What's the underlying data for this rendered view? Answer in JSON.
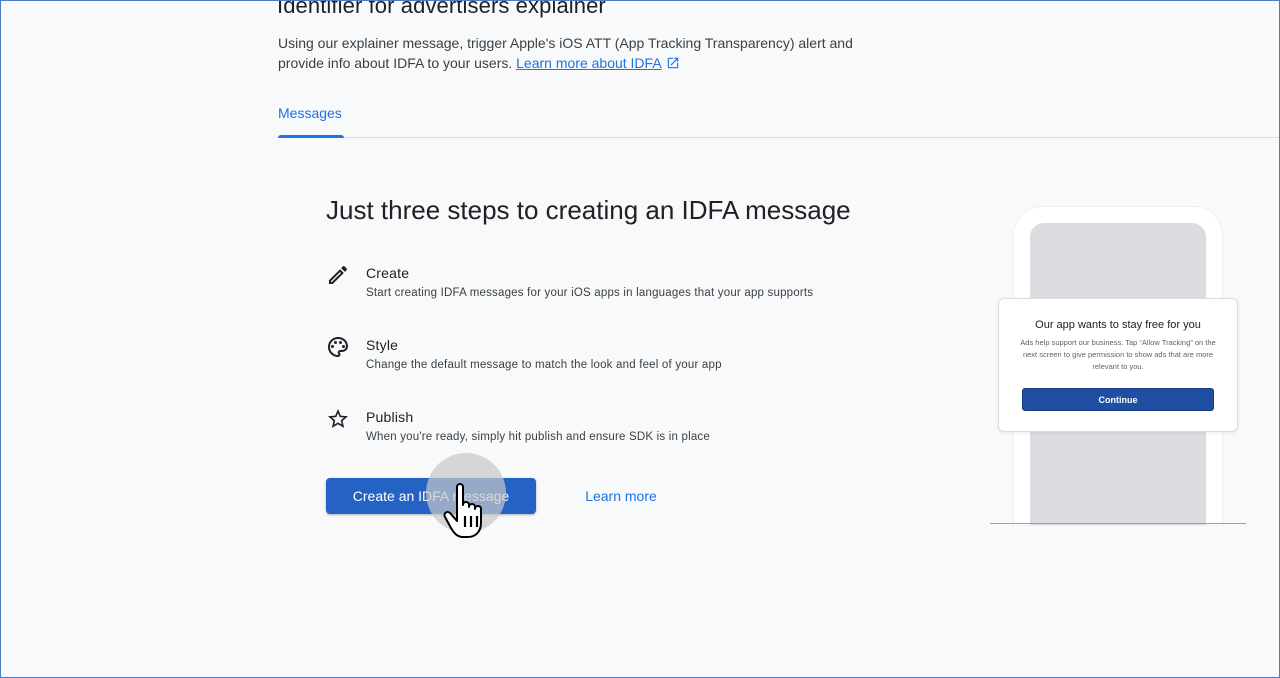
{
  "page": {
    "title": "Identifier for advertisers explainer",
    "description": "Using our explainer message, trigger Apple's iOS ATT (App Tracking Transparency) alert and provide info about IDFA to your users.",
    "learn_more_idfa": "Learn more about IDFA"
  },
  "tabs": [
    {
      "label": "Messages",
      "active": true
    }
  ],
  "main": {
    "heading": "Just three steps to creating an IDFA message",
    "steps": [
      {
        "icon": "pencil-icon",
        "title": "Create",
        "subtitle": "Start creating IDFA messages for your iOS apps in languages that your app supports"
      },
      {
        "icon": "palette-icon",
        "title": "Style",
        "subtitle": "Change the default message to match the look and feel of your app"
      },
      {
        "icon": "star-icon",
        "title": "Publish",
        "subtitle": "When you're ready, simply hit publish and ensure SDK is in place"
      }
    ],
    "create_button": "Create an IDFA message",
    "learn_more_button": "Learn more"
  },
  "preview": {
    "dialog_title": "Our app wants to stay free for you",
    "dialog_body": "Ads help support our business. Tap “Allow Tracking” on the next screen to give permission to show ads that are more relevant to you.",
    "dialog_button": "Continue"
  },
  "colors": {
    "accent": "#1a73e8",
    "primary_button": "#2463c4",
    "dialog_button": "#1f4fa3",
    "background": "#f8f9fa"
  }
}
